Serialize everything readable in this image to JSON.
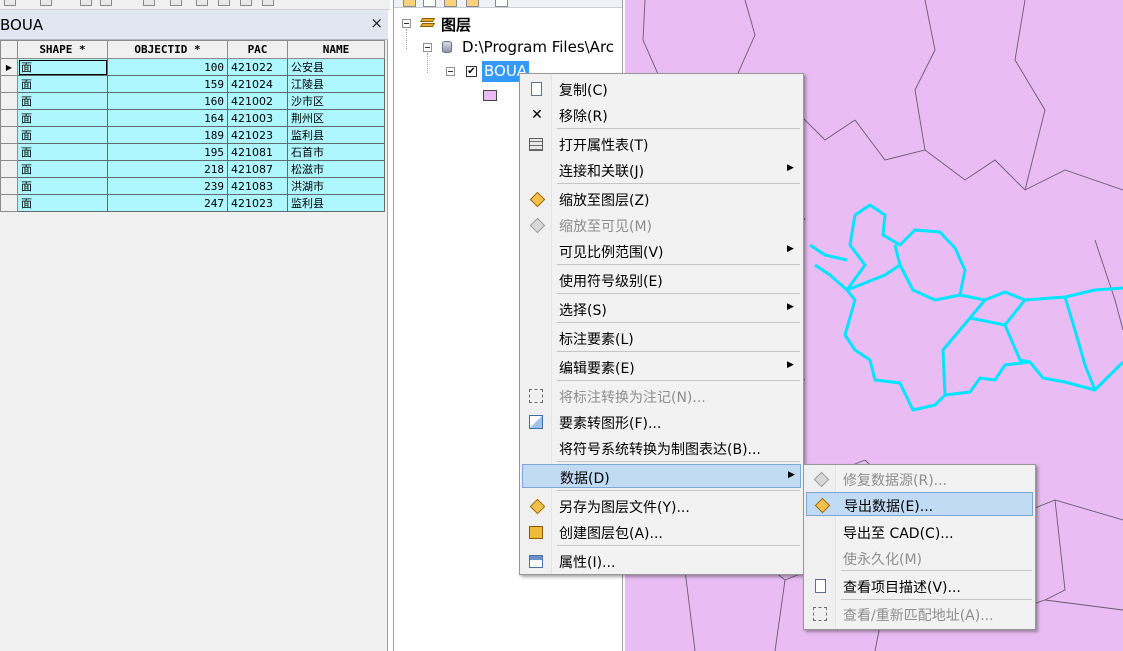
{
  "attribute_table": {
    "title": "BOUA",
    "close_icon": "×",
    "columns": [
      "SHAPE *",
      "OBJECTID *",
      "PAC",
      "NAME"
    ],
    "rows": [
      {
        "shape": "面",
        "objectid": "100",
        "pac": "421022",
        "name": "公安县"
      },
      {
        "shape": "面",
        "objectid": "159",
        "pac": "421024",
        "name": "江陵县"
      },
      {
        "shape": "面",
        "objectid": "160",
        "pac": "421002",
        "name": "沙市区"
      },
      {
        "shape": "面",
        "objectid": "164",
        "pac": "421003",
        "name": "荆州区"
      },
      {
        "shape": "面",
        "objectid": "189",
        "pac": "421023",
        "name": "监利县"
      },
      {
        "shape": "面",
        "objectid": "195",
        "pac": "421081",
        "name": "石首市"
      },
      {
        "shape": "面",
        "objectid": "218",
        "pac": "421087",
        "name": "松滋市"
      },
      {
        "shape": "面",
        "objectid": "239",
        "pac": "421083",
        "name": "洪湖市"
      },
      {
        "shape": "面",
        "objectid": "247",
        "pac": "421023",
        "name": "监利县"
      }
    ],
    "row_color": "#aff7ff"
  },
  "toc": {
    "root_label": "图层",
    "source_path": "D:\\Program Files\\Arc",
    "layer_name": "BOUA",
    "layer_checked": "✔",
    "swatch_color": "#e9bdf3"
  },
  "map": {
    "fill_color": "#e9bdf3",
    "selection_color": "#00e5ff"
  },
  "context_menu": {
    "items": [
      {
        "label": "复制(C)",
        "icon": "copy-icon",
        "enabled": true
      },
      {
        "label": "移除(R)",
        "icon": "remove-icon",
        "enabled": true
      },
      {
        "label": "打开属性表(T)",
        "icon": "table-icon",
        "enabled": true
      },
      {
        "label": "连接和关联(J)",
        "icon": "",
        "enabled": true,
        "submenu": true
      },
      {
        "label": "缩放至图层(Z)",
        "icon": "zoom-to-layer-icon",
        "enabled": true
      },
      {
        "label": "缩放至可见(M)",
        "icon": "zoom-to-visible-icon",
        "enabled": false
      },
      {
        "label": "可见比例范围(V)",
        "icon": "",
        "enabled": true,
        "submenu": true
      },
      {
        "label": "使用符号级别(E)",
        "icon": "",
        "enabled": true
      },
      {
        "label": "选择(S)",
        "icon": "",
        "enabled": true,
        "submenu": true
      },
      {
        "label": "标注要素(L)",
        "icon": "",
        "enabled": true
      },
      {
        "label": "编辑要素(E)",
        "icon": "",
        "enabled": true,
        "submenu": true
      },
      {
        "label": "将标注转换为注记(N)...",
        "icon": "convert-labels-icon",
        "enabled": false
      },
      {
        "label": "要素转图形(F)...",
        "icon": "features-to-graphics-icon",
        "enabled": true
      },
      {
        "label": "将符号系统转换为制图表达(B)...",
        "icon": "",
        "enabled": true
      },
      {
        "label": "数据(D)",
        "icon": "",
        "enabled": true,
        "submenu": true,
        "highlighted": true
      },
      {
        "label": "另存为图层文件(Y)...",
        "icon": "save-layer-icon",
        "enabled": true
      },
      {
        "label": "创建图层包(A)...",
        "icon": "layer-package-icon",
        "enabled": true
      },
      {
        "label": "属性(I)...",
        "icon": "properties-icon",
        "enabled": true
      }
    ],
    "submenu_arrow": "▶"
  },
  "data_submenu": {
    "items": [
      {
        "label": "修复数据源(R)...",
        "icon": "repair-source-icon",
        "enabled": false
      },
      {
        "label": "导出数据(E)...",
        "icon": "export-data-icon",
        "enabled": true,
        "highlighted": true
      },
      {
        "label": "导出至 CAD(C)...",
        "icon": "",
        "enabled": true
      },
      {
        "label": "使永久化(M)",
        "icon": "",
        "enabled": false
      },
      {
        "label": "查看项目描述(V)...",
        "icon": "item-description-icon",
        "enabled": true
      },
      {
        "label": "查看/重新匹配地址(A)...",
        "icon": "rematch-icon",
        "enabled": false
      }
    ]
  }
}
